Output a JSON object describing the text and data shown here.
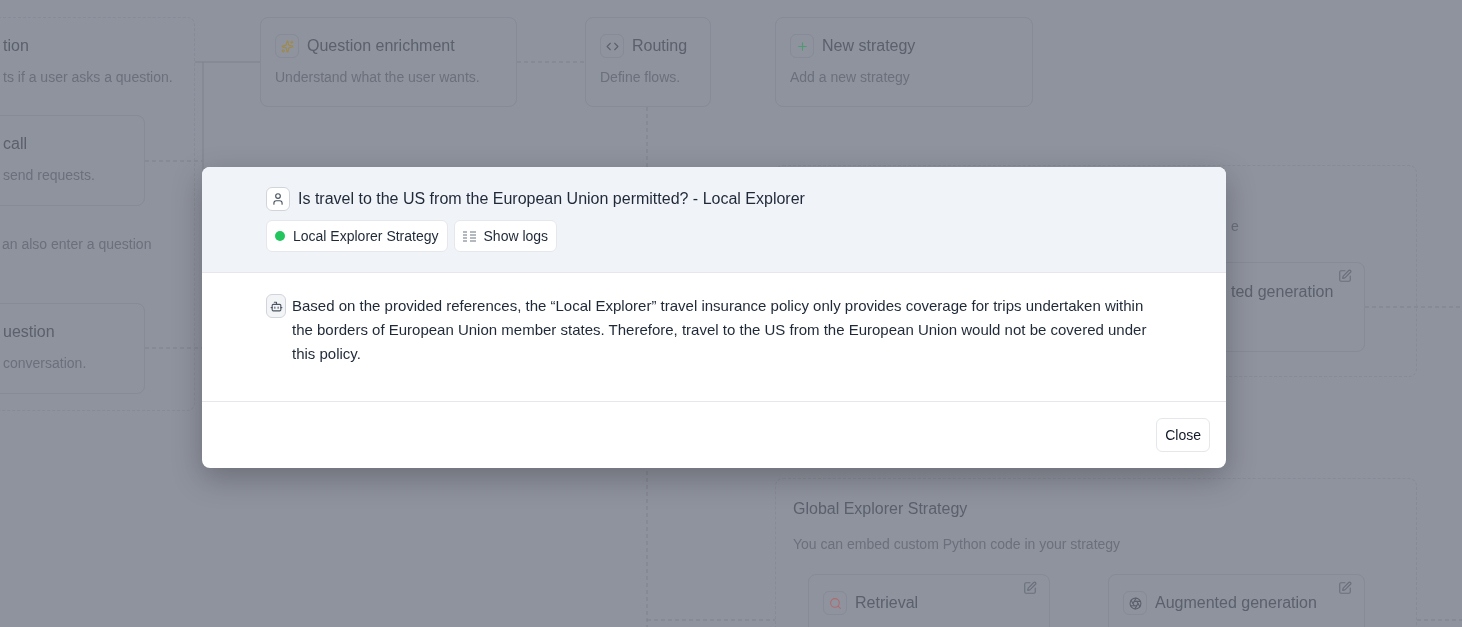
{
  "canvas": {
    "nodes": [
      {
        "kind": "plain",
        "title": "call",
        "description": "send requests.",
        "editable": false
      },
      {
        "kind": "plain",
        "title": "uestion",
        "description": "conversation.",
        "editable": false
      },
      {
        "kind": "sparkle",
        "title": "Question enrichment",
        "description": "Understand what the user wants.",
        "editable": false
      },
      {
        "kind": "code",
        "title": "Routing",
        "description": "Define flows.",
        "editable": false
      },
      {
        "kind": "plus",
        "title": "New strategy",
        "description": "Add a new strategy",
        "editable": false
      },
      {
        "kind": "plain",
        "title": "ted generation",
        "editable": true
      },
      {
        "kind": "search",
        "title": "Retrieval",
        "editable": true
      },
      {
        "kind": "aperture",
        "title": "Augmented generation",
        "editable": true
      }
    ],
    "note": "an also enter a question",
    "groups": [
      {
        "title": "tion",
        "description": "ts if a user asks a question."
      },
      {
        "description": "e"
      },
      {
        "title": "Global Explorer Strategy",
        "description": "You can embed custom Python code in your strategy"
      }
    ]
  },
  "dialog": {
    "question": "Is travel to the US from the European Union permitted? - Local Explorer",
    "strategy": {
      "label": "Local Explorer Strategy",
      "color": "#22c55e"
    },
    "logs_button": "Show logs",
    "answer": "Based on the provided references, the “Local Explorer” travel insurance policy only provides coverage for trips undertaken within the borders of European Union member states. Therefore, travel to the US from the European Union would not be covered under this policy.",
    "close_button": "Close"
  }
}
